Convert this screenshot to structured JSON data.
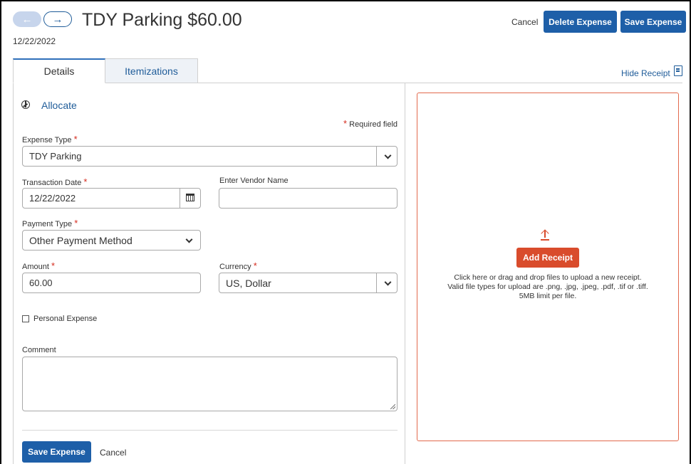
{
  "header": {
    "title": "TDY Parking $60.00",
    "date": "12/22/2022",
    "back_glyph": "←",
    "forward_glyph": "→",
    "cancel_label": "Cancel",
    "delete_label": "Delete Expense",
    "save_label": "Save Expense"
  },
  "tabs": [
    {
      "label": "Details",
      "active": true
    },
    {
      "label": "Itemizations",
      "active": false
    }
  ],
  "hide_receipt_label": "Hide Receipt",
  "form": {
    "allocate_label": "Allocate",
    "required_note": "Required field",
    "required_marker": "*",
    "expense_type": {
      "label": "Expense Type",
      "value": "TDY Parking"
    },
    "transaction_date": {
      "label": "Transaction Date",
      "value": "12/22/2022"
    },
    "vendor": {
      "label": "Enter Vendor Name",
      "value": ""
    },
    "payment_type": {
      "label": "Payment Type",
      "value": "Other Payment Method"
    },
    "amount": {
      "label": "Amount",
      "value": "60.00"
    },
    "currency": {
      "label": "Currency",
      "value": "US, Dollar"
    },
    "personal_expense": {
      "label": "Personal Expense",
      "checked": false
    },
    "comment": {
      "label": "Comment",
      "value": ""
    },
    "save_label": "Save Expense",
    "cancel_label": "Cancel"
  },
  "receipt": {
    "add_label": "Add Receipt",
    "line1": "Click here or drag and drop files to upload a new receipt.",
    "line2": "Valid file types for upload are .png, .jpg, .jpeg, .pdf, .tif or .tiff.",
    "line3": "5MB limit per file."
  },
  "colors": {
    "primary": "#1e5fa8",
    "link": "#1f5c99",
    "required": "#d52b1e",
    "receipt_accent": "#d94c2c"
  }
}
